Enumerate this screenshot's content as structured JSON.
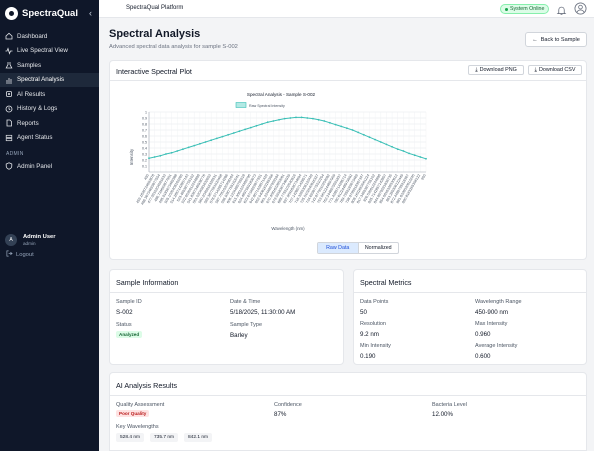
{
  "sidebar": {
    "brand": "SpectraQual",
    "collapse_icon": "chevron-left-icon",
    "items": [
      {
        "label": "Dashboard",
        "icon": "home-icon"
      },
      {
        "label": "Live Spectral View",
        "icon": "activity-icon"
      },
      {
        "label": "Samples",
        "icon": "flask-icon"
      },
      {
        "label": "Spectral Analysis",
        "icon": "chart-icon"
      },
      {
        "label": "AI Results",
        "icon": "brain-icon"
      },
      {
        "label": "History & Logs",
        "icon": "history-icon"
      },
      {
        "label": "Reports",
        "icon": "file-icon"
      },
      {
        "label": "Agent Status",
        "icon": "server-icon"
      }
    ],
    "admin_section": "ADMIN",
    "admin_items": [
      {
        "label": "Admin Panel",
        "icon": "shield-icon"
      }
    ],
    "user": {
      "initial": "A",
      "name": "Admin User",
      "role": "admin"
    },
    "logout": "Logout"
  },
  "topbar": {
    "title": "SpectraQual Platform",
    "status": "System Online"
  },
  "page": {
    "title": "Spectral Analysis",
    "subtitle": "Advanced spectral data analysis for sample S-002",
    "back": "Back to Sample"
  },
  "plot_card": {
    "title": "Interactive Spectral Plot",
    "download_png": "Download PNG",
    "download_csv": "Download CSV",
    "toggle": [
      "Raw Data",
      "Normalized"
    ]
  },
  "chart_data": {
    "type": "line",
    "title": "Spectral Analysis - Sample S-002",
    "legend": "Raw Spectral Intensity",
    "xlabel": "Wavelength (nm)",
    "ylabel": "Intensity",
    "ylim": [
      0,
      1.0
    ],
    "yticks": [
      0.1,
      0.2,
      0.3,
      0.4,
      0.5,
      0.6,
      0.7,
      0.8,
      0.9,
      1.0
    ],
    "x": [
      450,
      459.1836734693878,
      468.36734693877554,
      477.5510204081633,
      486.734693877551,
      495.9183673469388,
      505.1020408163265,
      514.2857142857143,
      523.469387755102,
      532.6530612244898,
      541.8367346938776,
      551.0204081632653,
      560.2040816326531,
      569.3877551020408,
      578.5714285714286,
      587.7551020408164,
      596.9387755102041,
      606.1224489795918,
      615.3061224489796,
      624.4897959183673,
      633.6734693877551,
      642.8571428571429,
      652.0408163265306,
      661.2244897959184,
      670.4081632653061,
      679.5918367346939,
      688.7755102040816,
      697.9591836734694,
      707.1428571428571,
      716.3265306122449,
      725.5102040816327,
      734.6938775510204,
      743.8775510204082,
      753.0612244897959,
      762.2448979591837,
      771.4285714285714,
      780.6122448979592,
      789.7959183673469,
      798.9795918367347,
      808.1632653061224,
      817.3469387755102,
      826.530612244898,
      835.7142857142857,
      844.8979591836735,
      854.0816326530612,
      863.265306122449,
      872.4489795918367,
      881.6326530612245,
      890.8163265306122,
      900
    ],
    "y": [
      0.23,
      0.25,
      0.27,
      0.3,
      0.32,
      0.35,
      0.38,
      0.41,
      0.44,
      0.47,
      0.5,
      0.53,
      0.56,
      0.59,
      0.62,
      0.65,
      0.68,
      0.71,
      0.74,
      0.77,
      0.8,
      0.83,
      0.85,
      0.87,
      0.89,
      0.9,
      0.91,
      0.91,
      0.9,
      0.89,
      0.87,
      0.85,
      0.82,
      0.79,
      0.76,
      0.73,
      0.7,
      0.66,
      0.62,
      0.58,
      0.54,
      0.5,
      0.46,
      0.42,
      0.38,
      0.35,
      0.31,
      0.28,
      0.25,
      0.22
    ],
    "grid": true,
    "legend_position": "top-center",
    "color": "#3bbfb6"
  },
  "sample_info": {
    "title": "Sample Information",
    "sample_id_label": "Sample ID",
    "sample_id": "S-002",
    "datetime_label": "Date & Time",
    "datetime": "5/18/2025, 11:30:00 AM",
    "status_label": "Status",
    "status": "Analyzed",
    "sample_type_label": "Sample Type",
    "sample_type": "Barley"
  },
  "metrics": {
    "title": "Spectral Metrics",
    "items": [
      {
        "label": "Data Points",
        "value": "50"
      },
      {
        "label": "Wavelength Range",
        "value": "450-900 nm"
      },
      {
        "label": "Resolution",
        "value": "9.2 nm"
      },
      {
        "label": "Max Intensity",
        "value": "0.960"
      },
      {
        "label": "Min Intensity",
        "value": "0.190"
      },
      {
        "label": "Average Intensity",
        "value": "0.600"
      }
    ]
  },
  "ai": {
    "title": "AI Analysis Results",
    "quality_label": "Quality Assessment",
    "quality": "Poor Quality",
    "confidence_label": "Confidence",
    "confidence": "87%",
    "bacteria_label": "Bacteria Level",
    "bacteria": "12.00%",
    "key_wl_label": "Key Wavelengths",
    "key_wavelengths": [
      "528.4 nm",
      "735.7 nm",
      "842.1 nm"
    ]
  }
}
